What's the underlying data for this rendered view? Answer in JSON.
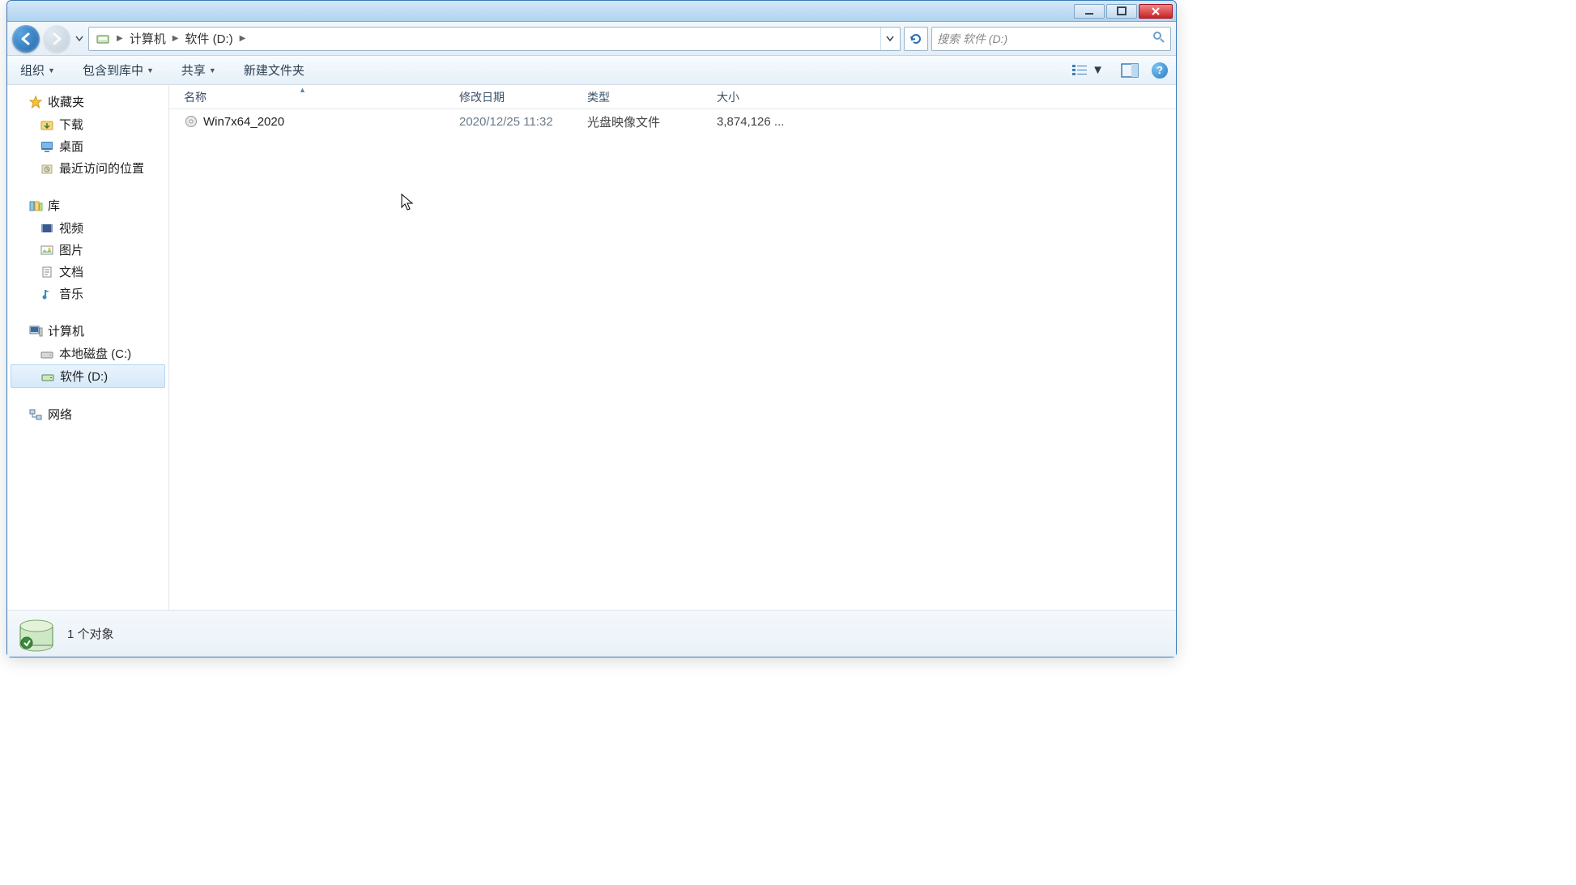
{
  "titlebar": {
    "minimize": "_",
    "maximize": "□",
    "close": "✕"
  },
  "nav": {
    "breadcrumb": [
      "计算机",
      "软件 (D:)"
    ],
    "search_placeholder": "搜索 软件 (D:)"
  },
  "toolbar": {
    "organize": "组织",
    "include": "包含到库中",
    "share": "共享",
    "newfolder": "新建文件夹"
  },
  "sidebar": {
    "favorites": {
      "label": "收藏夹",
      "items": [
        "下载",
        "桌面",
        "最近访问的位置"
      ]
    },
    "libraries": {
      "label": "库",
      "items": [
        "视频",
        "图片",
        "文档",
        "音乐"
      ]
    },
    "computer": {
      "label": "计算机",
      "items": [
        "本地磁盘 (C:)",
        "软件 (D:)"
      ],
      "selected_index": 1
    },
    "network": {
      "label": "网络"
    }
  },
  "columns": {
    "name": "名称",
    "date": "修改日期",
    "type": "类型",
    "size": "大小"
  },
  "files": [
    {
      "name": "Win7x64_2020",
      "date": "2020/12/25 11:32",
      "type": "光盘映像文件",
      "size": "3,874,126 ..."
    }
  ],
  "status": {
    "text": "1 个对象"
  }
}
